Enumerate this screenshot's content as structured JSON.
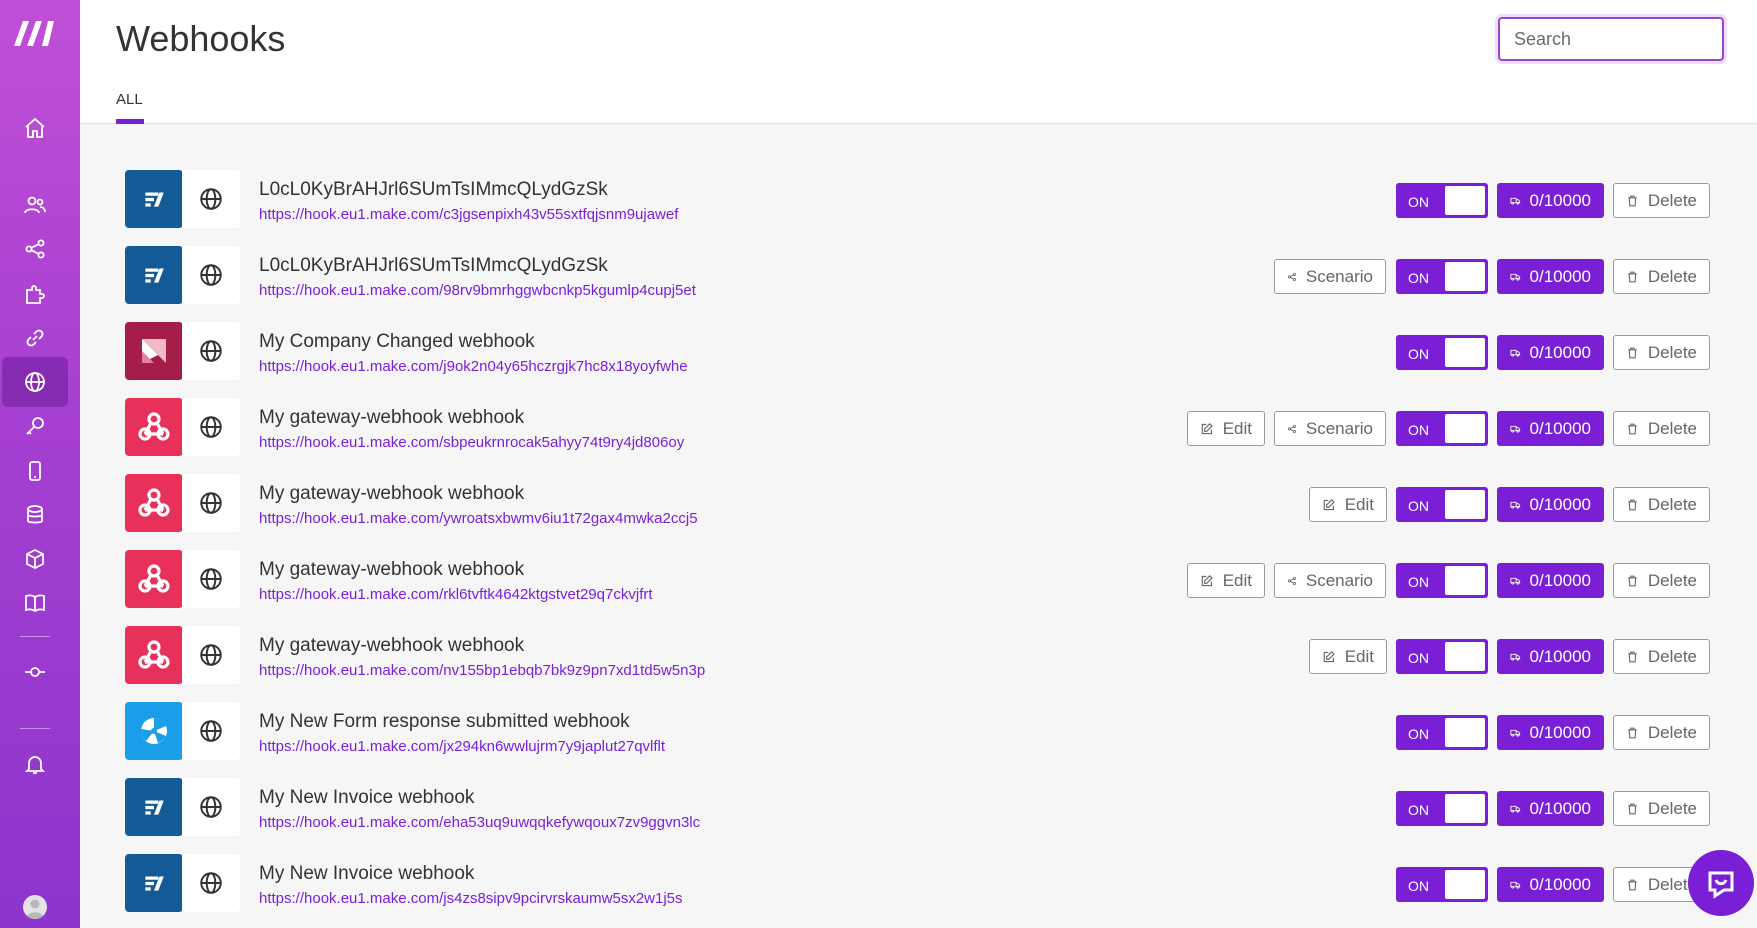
{
  "app": {
    "title": "Webhooks",
    "search_placeholder": "Search",
    "tabs": [
      {
        "label": "ALL",
        "active": true
      }
    ],
    "accent_color": "#7b1fd6"
  },
  "sidebar": {
    "items": [
      {
        "icon": "home-icon"
      },
      {
        "icon": "users-icon"
      },
      {
        "icon": "share-icon"
      },
      {
        "icon": "puzzle-icon"
      },
      {
        "icon": "link-icon"
      },
      {
        "icon": "globe-icon",
        "active": true
      },
      {
        "icon": "key-icon"
      },
      {
        "icon": "mobile-icon"
      },
      {
        "icon": "database-icon"
      },
      {
        "icon": "box-icon"
      },
      {
        "icon": "book-icon"
      },
      {
        "icon": "commit-icon"
      },
      {
        "icon": "bell-icon"
      }
    ]
  },
  "labels": {
    "on": "ON",
    "ops": "0/10000",
    "delete": "Delete",
    "edit": "Edit",
    "scenario": "Scenario"
  },
  "webhooks": [
    {
      "app_icon": "app-blue-doc",
      "name": "L0cL0KyBrAHJrl6SUmTsIMmcQLydGzSk",
      "url": "https://hook.eu1.make.com/c3jgsenpixh43v55sxtfqjsnm9ujawef",
      "edit": false,
      "scenario": false
    },
    {
      "app_icon": "app-blue-doc",
      "name": "L0cL0KyBrAHJrl6SUmTsIMmcQLydGzSk",
      "url": "https://hook.eu1.make.com/98rv9bmrhggwbcnkp5kgumlp4cupj5et",
      "edit": false,
      "scenario": true
    },
    {
      "app_icon": "app-company",
      "name": "My Company Changed webhook",
      "url": "https://hook.eu1.make.com/j9ok2n04y65hczrgjk7hc8x18yoyfwhe",
      "edit": false,
      "scenario": false
    },
    {
      "app_icon": "app-webhook",
      "name": "My gateway-webhook webhook",
      "url": "https://hook.eu1.make.com/sbpeukrnrocak5ahyy74t9ry4jd806oy",
      "edit": true,
      "scenario": true
    },
    {
      "app_icon": "app-webhook",
      "name": "My gateway-webhook webhook",
      "url": "https://hook.eu1.make.com/ywroatsxbwmv6iu1t72gax4mwka2ccj5",
      "edit": true,
      "scenario": false
    },
    {
      "app_icon": "app-webhook",
      "name": "My gateway-webhook webhook",
      "url": "https://hook.eu1.make.com/rkl6tvftk4642ktgstvet29q7ckvjfrt",
      "edit": true,
      "scenario": true
    },
    {
      "app_icon": "app-webhook",
      "name": "My gateway-webhook webhook",
      "url": "https://hook.eu1.make.com/nv155bp1ebqb7bk9z9pn7xd1td5w5n3p",
      "edit": true,
      "scenario": false
    },
    {
      "app_icon": "app-form",
      "name": "My New Form response submitted webhook",
      "url": "https://hook.eu1.make.com/jx294kn6wwlujrm7y9japlut27qvlflt",
      "edit": false,
      "scenario": false
    },
    {
      "app_icon": "app-blue-doc",
      "name": "My New Invoice webhook",
      "url": "https://hook.eu1.make.com/eha53uq9uwqqkefywqoux7zv9ggvn3lc",
      "edit": false,
      "scenario": false
    },
    {
      "app_icon": "app-blue-doc",
      "name": "My New Invoice webhook",
      "url": "https://hook.eu1.make.com/js4zs8sipv9pcirvrskaumw5sx2w1j5s",
      "edit": false,
      "scenario": false
    }
  ]
}
